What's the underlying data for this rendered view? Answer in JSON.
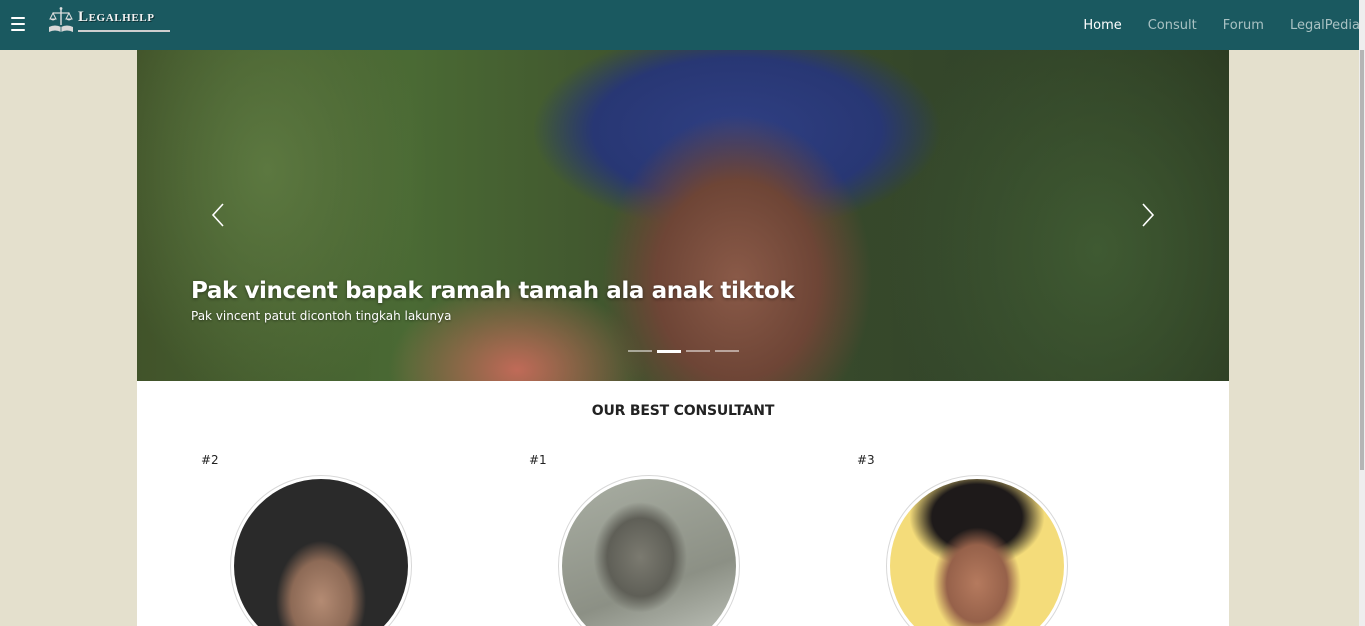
{
  "navbar": {
    "brand": "Legalhelp",
    "links": [
      {
        "label": "Home",
        "active": true
      },
      {
        "label": "Consult",
        "active": false
      },
      {
        "label": "Forum",
        "active": false
      },
      {
        "label": "LegalPedia",
        "active": false
      }
    ],
    "background": "#1a5960"
  },
  "carousel": {
    "slide": {
      "title": "Pak vincent bapak ramah tamah ala anak tiktok",
      "subtitle": "Pak vincent patut dicontoh tingkah lakunya"
    },
    "slide_count": 4,
    "active_index": 1
  },
  "consultants": {
    "heading": "OUR BEST CONSULTANT",
    "cards": [
      {
        "rank": "#2"
      },
      {
        "rank": "#1"
      },
      {
        "rank": "#3"
      }
    ]
  },
  "colors": {
    "page_background": "#e4e0cd",
    "nav_active": "#ffffff",
    "nav_inactive": "#a9c2c3"
  }
}
